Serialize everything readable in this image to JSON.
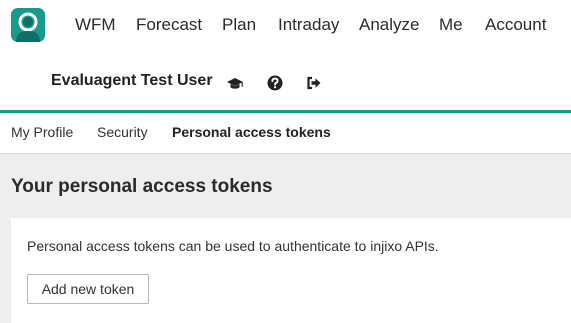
{
  "nav": {
    "items": [
      "WFM",
      "Forecast",
      "Plan",
      "Intraday",
      "Analyze",
      "Me",
      "Account"
    ]
  },
  "user": {
    "name": "Evaluagent Test User",
    "icons": [
      "graduation-cap-icon",
      "help-circle-icon",
      "sign-out-icon"
    ]
  },
  "subtabs": {
    "items": [
      "My Profile",
      "Security",
      "Personal access tokens"
    ],
    "active": "Personal access tokens"
  },
  "main": {
    "title": "Your personal access tokens",
    "description": "Personal access tokens can be used to authenticate to injixo APIs.",
    "add_button": "Add new token"
  },
  "colors": {
    "accent": "#1a9a8c",
    "background": "#eeeeee"
  }
}
